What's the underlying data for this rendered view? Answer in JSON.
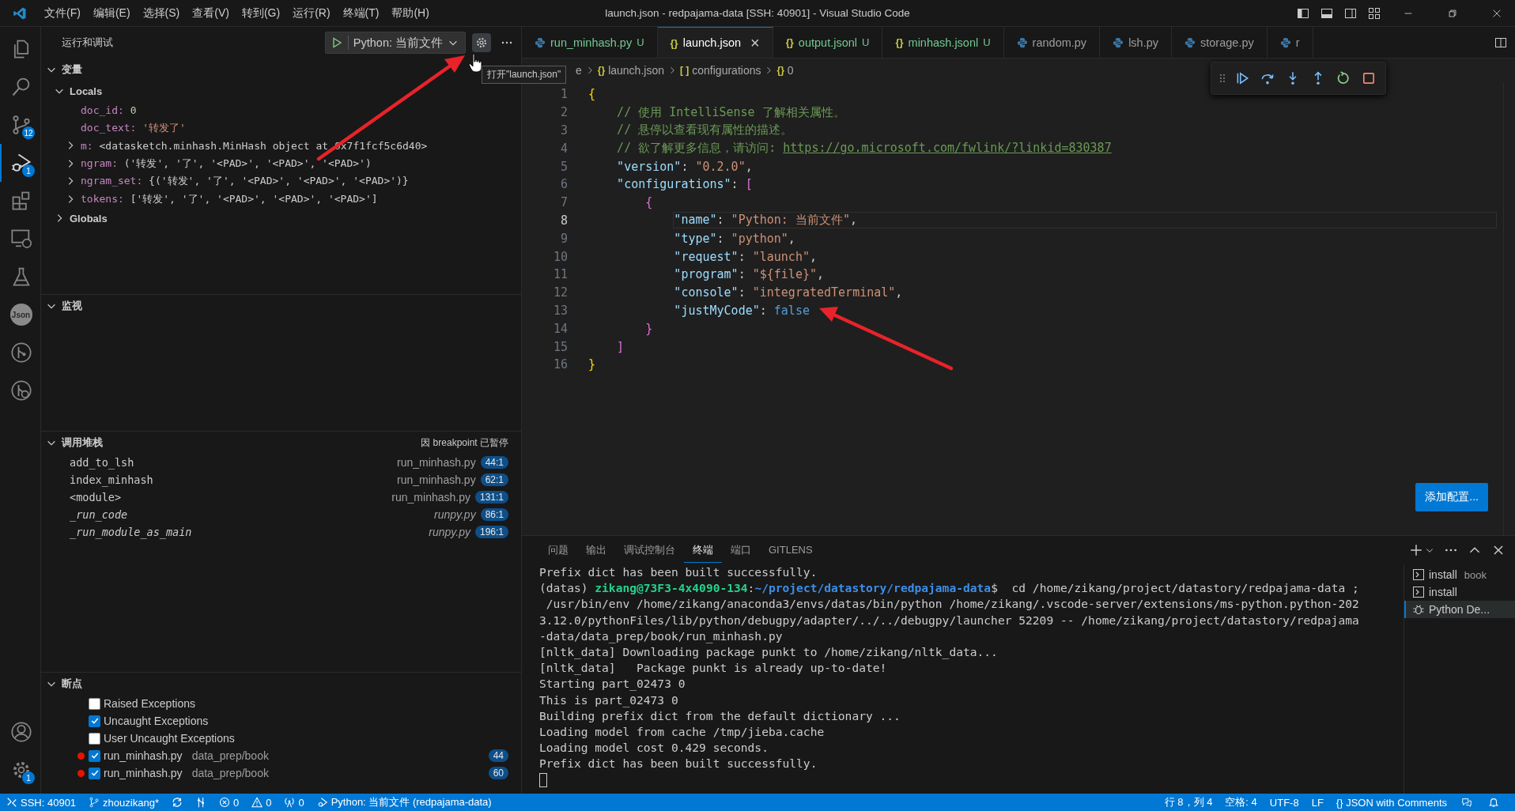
{
  "title_bar": {
    "menu": [
      "文件(F)",
      "编辑(E)",
      "选择(S)",
      "查看(V)",
      "转到(G)",
      "运行(R)",
      "终端(T)",
      "帮助(H)"
    ],
    "title": "launch.json - redpajama-data [SSH: 40901] - Visual Studio Code"
  },
  "activity_bar": {
    "items": [
      {
        "kind": "explorer",
        "selected": false
      },
      {
        "kind": "search",
        "selected": false
      },
      {
        "kind": "source-control",
        "badge": "12",
        "selected": false
      },
      {
        "kind": "run-debug",
        "badge": "1",
        "selected": true
      },
      {
        "kind": "extensions",
        "selected": false
      },
      {
        "kind": "remote",
        "selected": false
      },
      {
        "kind": "testing",
        "selected": false
      },
      {
        "kind": "json",
        "label": "Json",
        "selected": false
      },
      {
        "kind": "git-graph",
        "selected": false
      },
      {
        "kind": "gitlens",
        "selected": false
      }
    ],
    "bottom": [
      {
        "kind": "account"
      },
      {
        "kind": "settings",
        "badge": "1"
      }
    ]
  },
  "sidebar": {
    "title": "运行和调试",
    "launch_config": "Python: 当前文件",
    "tooltip": "打开\"launch.json\"",
    "variables": {
      "title": "变量",
      "expanded": true,
      "scopes": [
        {
          "label": "Locals",
          "expanded": true,
          "children": [
            {
              "name": "doc_id:",
              "value": "0",
              "kind": "number",
              "expandable": false
            },
            {
              "name": "doc_text:",
              "value": "'转发了'",
              "kind": "string",
              "expandable": false
            },
            {
              "name": "m:",
              "value": "<datasketch.minhash.MinHash object at 0x7f1fcf5c6d40>",
              "kind": "object",
              "expandable": true
            },
            {
              "name": "ngram:",
              "value": "('转发', '了', '<PAD>', '<PAD>', '<PAD>')",
              "kind": "object",
              "expandable": true
            },
            {
              "name": "ngram_set:",
              "value": "{('转发', '了', '<PAD>', '<PAD>', '<PAD>')}",
              "kind": "object",
              "expandable": true
            },
            {
              "name": "tokens:",
              "value": "['转发', '了', '<PAD>', '<PAD>', '<PAD>']",
              "kind": "object",
              "expandable": true
            }
          ]
        },
        {
          "label": "Globals",
          "expanded": false
        }
      ]
    },
    "watch": {
      "title": "监视",
      "expanded": true
    },
    "call_stack": {
      "title": "调用堆栈",
      "expanded": true,
      "status": "因 breakpoint 已暂停",
      "frames": [
        {
          "name": "add_to_lsh",
          "file": "run_minhash.py",
          "line": "44:1",
          "kind": "user"
        },
        {
          "name": "index_minhash",
          "file": "run_minhash.py",
          "line": "62:1",
          "kind": "user"
        },
        {
          "name": "<module>",
          "file": "run_minhash.py",
          "line": "131:1",
          "kind": "user"
        },
        {
          "name": "_run_code",
          "file": "runpy.py",
          "line": "86:1",
          "kind": "library"
        },
        {
          "name": "_run_module_as_main",
          "file": "runpy.py",
          "line": "196:1",
          "kind": "library"
        }
      ]
    },
    "breakpoints": {
      "title": "断点",
      "expanded": true,
      "items": [
        {
          "kind": "exception",
          "label": "Raised Exceptions",
          "checked": false
        },
        {
          "kind": "exception",
          "label": "Uncaught Exceptions",
          "checked": true
        },
        {
          "kind": "exception",
          "label": "User Uncaught Exceptions",
          "checked": false
        },
        {
          "kind": "source",
          "label": "run_minhash.py",
          "path": "data_prep/book",
          "line": "44",
          "checked": true
        },
        {
          "kind": "source",
          "label": "run_minhash.py",
          "path": "data_prep/book",
          "line": "60",
          "checked": true
        }
      ]
    }
  },
  "editor": {
    "tabs": [
      {
        "label": "run_minhash.py",
        "kind": "python",
        "status": "U",
        "selected": false
      },
      {
        "label": "launch.json",
        "kind": "json",
        "glyph": "{}",
        "close": "×",
        "selected": true
      },
      {
        "label": "output.jsonl",
        "kind": "json",
        "glyph": "{}",
        "status": "U",
        "selected": false
      },
      {
        "label": "minhash.jsonl",
        "kind": "json",
        "glyph": "{}",
        "status": "U",
        "selected": false
      },
      {
        "label": "random.py",
        "kind": "python",
        "selected": false
      },
      {
        "label": "lsh.py",
        "kind": "python",
        "selected": false
      },
      {
        "label": "storage.py",
        "kind": "python",
        "selected": false
      },
      {
        "label": "r",
        "kind": "python",
        "selected": false
      }
    ],
    "breadcrumb": [
      {
        "label": "e"
      },
      {
        "glyph": "{}",
        "label": "launch.json"
      },
      {
        "glyph": "[ ]",
        "label": "configurations"
      },
      {
        "glyph": "{}",
        "label": "0"
      }
    ],
    "lines": [
      {
        "n": "1",
        "current": false,
        "tokens": [
          {
            "kind": "brace",
            "t": "{"
          }
        ],
        "children": [
          {
            "n": "2",
            "current": false,
            "tokens": [
              {
                "kind": "comment",
                "t": "// 使用 IntelliSense 了解相关属性。"
              }
            ]
          },
          {
            "n": "3",
            "current": false,
            "tokens": [
              {
                "kind": "comment",
                "t": "// 悬停以查看现有属性的描述。"
              }
            ]
          },
          {
            "n": "4",
            "current": false,
            "tokens": [
              {
                "kind": "comment",
                "t": "// 欲了解更多信息，请访问: "
              },
              {
                "kind": "link",
                "t": "https://go.microsoft.com/fwlink/?linkid=830387"
              }
            ]
          },
          {
            "n": "5",
            "current": false,
            "tokens": [
              {
                "kind": "key",
                "t": "\"version\""
              },
              {
                "kind": "punct",
                "t": ": "
              },
              {
                "kind": "string",
                "t": "\"0.2.0\""
              },
              {
                "kind": "punct",
                "t": ","
              }
            ]
          },
          {
            "n": "6",
            "current": false,
            "tokens": [
              {
                "kind": "key",
                "t": "\"configurations\""
              },
              {
                "kind": "punct",
                "t": ": "
              },
              {
                "kind": "bracket",
                "t": "["
              }
            ],
            "children": [
              {
                "n": "7",
                "current": false,
                "tokens": [
                  {
                    "kind": "brace2",
                    "t": "{"
                  }
                ],
                "children": [
                  {
                    "n": "8",
                    "current": true,
                    "tokens": [
                      {
                        "kind": "key",
                        "t": "\"name\""
                      },
                      {
                        "kind": "punct",
                        "t": ": "
                      },
                      {
                        "kind": "string",
                        "t": "\"Python: 当前文件\""
                      },
                      {
                        "kind": "punct",
                        "t": ","
                      }
                    ]
                  },
                  {
                    "n": "9",
                    "current": false,
                    "tokens": [
                      {
                        "kind": "key",
                        "t": "\"type\""
                      },
                      {
                        "kind": "punct",
                        "t": ": "
                      },
                      {
                        "kind": "string",
                        "t": "\"python\""
                      },
                      {
                        "kind": "punct",
                        "t": ","
                      }
                    ]
                  },
                  {
                    "n": "10",
                    "current": false,
                    "tokens": [
                      {
                        "kind": "key",
                        "t": "\"request\""
                      },
                      {
                        "kind": "punct",
                        "t": ": "
                      },
                      {
                        "kind": "string",
                        "t": "\"launch\""
                      },
                      {
                        "kind": "punct",
                        "t": ","
                      }
                    ]
                  },
                  {
                    "n": "11",
                    "current": false,
                    "tokens": [
                      {
                        "kind": "key",
                        "t": "\"program\""
                      },
                      {
                        "kind": "punct",
                        "t": ": "
                      },
                      {
                        "kind": "string",
                        "t": "\"${file}\""
                      },
                      {
                        "kind": "punct",
                        "t": ","
                      }
                    ]
                  },
                  {
                    "n": "12",
                    "current": false,
                    "tokens": [
                      {
                        "kind": "key",
                        "t": "\"console\""
                      },
                      {
                        "kind": "punct",
                        "t": ": "
                      },
                      {
                        "kind": "string",
                        "t": "\"integratedTerminal\""
                      },
                      {
                        "kind": "punct",
                        "t": ","
                      }
                    ]
                  },
                  {
                    "n": "13",
                    "current": false,
                    "tokens": [
                      {
                        "kind": "key",
                        "t": "\"justMyCode\""
                      },
                      {
                        "kind": "punct",
                        "t": ": "
                      },
                      {
                        "kind": "bool",
                        "t": "false"
                      }
                    ]
                  }
                ]
              },
              {
                "n": "14",
                "current": false,
                "tokens": [
                  {
                    "kind": "brace2",
                    "t": "}"
                  }
                ]
              }
            ]
          },
          {
            "n": "15",
            "current": false,
            "tokens": [
              {
                "kind": "bracket",
                "t": "]"
              }
            ]
          }
        ]
      },
      {
        "n": "16",
        "current": false,
        "tokens": [
          {
            "kind": "brace",
            "t": "}"
          }
        ]
      }
    ],
    "debug_toolbar": [
      {
        "kind": "grip"
      },
      {
        "kind": "continue"
      },
      {
        "kind": "step-over"
      },
      {
        "kind": "step-into"
      },
      {
        "kind": "step-out"
      },
      {
        "kind": "restart"
      },
      {
        "kind": "stop"
      }
    ],
    "add_config_button": "添加配置..."
  },
  "panel": {
    "tabs": [
      {
        "label": "问题",
        "selected": false
      },
      {
        "label": "输出",
        "selected": false
      },
      {
        "label": "调试控制台",
        "selected": false
      },
      {
        "label": "终端",
        "selected": true
      },
      {
        "label": "端口",
        "selected": false
      },
      {
        "label": "GITLENS",
        "selected": false
      }
    ],
    "terminal_lines": [
      [
        {
          "kind": "plain",
          "t": "Prefix dict has been built successfully."
        }
      ],
      [
        {
          "kind": "plain",
          "t": "(datas) "
        },
        {
          "kind": "user",
          "t": "zikang@73F3-4x4090-134"
        },
        {
          "kind": "plain",
          "t": ":"
        },
        {
          "kind": "path",
          "t": "~/project/datastory/redpajama-data"
        },
        {
          "kind": "plain",
          "t": "$  cd /home/zikang/project/datastory/redpajama-data ;"
        }
      ],
      [
        {
          "kind": "plain",
          "t": " /usr/bin/env /home/zikang/anaconda3/envs/datas/bin/python /home/zikang/.vscode-server/extensions/ms-python.python-202"
        }
      ],
      [
        {
          "kind": "plain",
          "t": "3.12.0/pythonFiles/lib/python/debugpy/adapter/../../debugpy/launcher 52209 -- /home/zikang/project/datastory/redpajama"
        }
      ],
      [
        {
          "kind": "plain",
          "t": "-data/data_prep/book/run_minhash.py"
        }
      ],
      [
        {
          "kind": "plain",
          "t": "[nltk_data] Downloading package punkt to /home/zikang/nltk_data..."
        }
      ],
      [
        {
          "kind": "plain",
          "t": "[nltk_data]   Package punkt is already up-to-date!"
        }
      ],
      [
        {
          "kind": "plain",
          "t": "Starting part_02473 0"
        }
      ],
      [
        {
          "kind": "plain",
          "t": "This is part_02473 0"
        }
      ],
      [
        {
          "kind": "plain",
          "t": "Building prefix dict from the default dictionary ..."
        }
      ],
      [
        {
          "kind": "plain",
          "t": "Loading model from cache /tmp/jieba.cache"
        }
      ],
      [
        {
          "kind": "plain",
          "t": "Loading model cost 0.429 seconds."
        }
      ],
      [
        {
          "kind": "plain",
          "t": "Prefix dict has been built successfully."
        }
      ]
    ],
    "terminals": [
      {
        "label": "install",
        "detail": "book",
        "kind": "shell",
        "selected": false
      },
      {
        "label": "install",
        "kind": "shell",
        "selected": false
      },
      {
        "label": "Python De...",
        "kind": "debug",
        "selected": true
      }
    ]
  },
  "status_bar": {
    "left": [
      {
        "kind": "remote",
        "label": "SSH: 40901"
      },
      {
        "kind": "branch",
        "label": "zhouzikang*"
      },
      {
        "kind": "sync"
      },
      {
        "kind": "graph"
      },
      {
        "kind": "errors",
        "label": "0"
      },
      {
        "kind": "warnings",
        "label": "0"
      },
      {
        "kind": "ports",
        "label": "0"
      },
      {
        "kind": "debug",
        "label": "Python: 当前文件 (redpajama-data)"
      }
    ],
    "right": [
      {
        "label": "行 8，列 4"
      },
      {
        "label": "空格: 4"
      },
      {
        "label": "UTF-8"
      },
      {
        "label": "LF"
      },
      {
        "label": "{} JSON with Comments"
      }
    ]
  }
}
